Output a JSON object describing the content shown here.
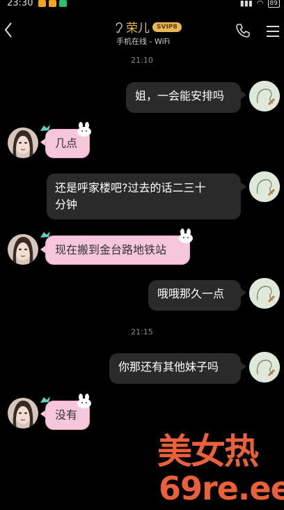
{
  "status_bar": {
    "time": "23:30",
    "battery": "89"
  },
  "header": {
    "contact_name": "荣儿",
    "vip_badge": "SVIP8",
    "subtitle": "手机在线 - WiFi",
    "icons": [
      "back-arrow-icon",
      "hearing-icon",
      "phone-icon",
      "menu-icon"
    ]
  },
  "chat": {
    "timestamps": [
      "21:10",
      "21:15"
    ],
    "messages": [
      {
        "from": "me",
        "text": "姐，一会能安排吗"
      },
      {
        "from": "them",
        "text": "几点"
      },
      {
        "from": "me",
        "text": "还是呼家楼吧?过去的话二三十"
      },
      {
        "from": "me_cont",
        "text": "分钟"
      },
      {
        "from": "them",
        "text": "现在搬到金台路地铁站"
      },
      {
        "from": "me",
        "text": "哦哦那久一点"
      },
      {
        "from": "me",
        "text": "你那还有其他妹子吗"
      },
      {
        "from": "them",
        "text": "没有"
      }
    ]
  },
  "watermark": {
    "line1": "美女热",
    "line2": "69re.ee"
  },
  "colors": {
    "background": "#000000",
    "accent_gold": "#e8b75a",
    "bubble_me": "#2a2a2a",
    "bubble_them": "#f6c7da",
    "watermark": "#e8613a"
  }
}
